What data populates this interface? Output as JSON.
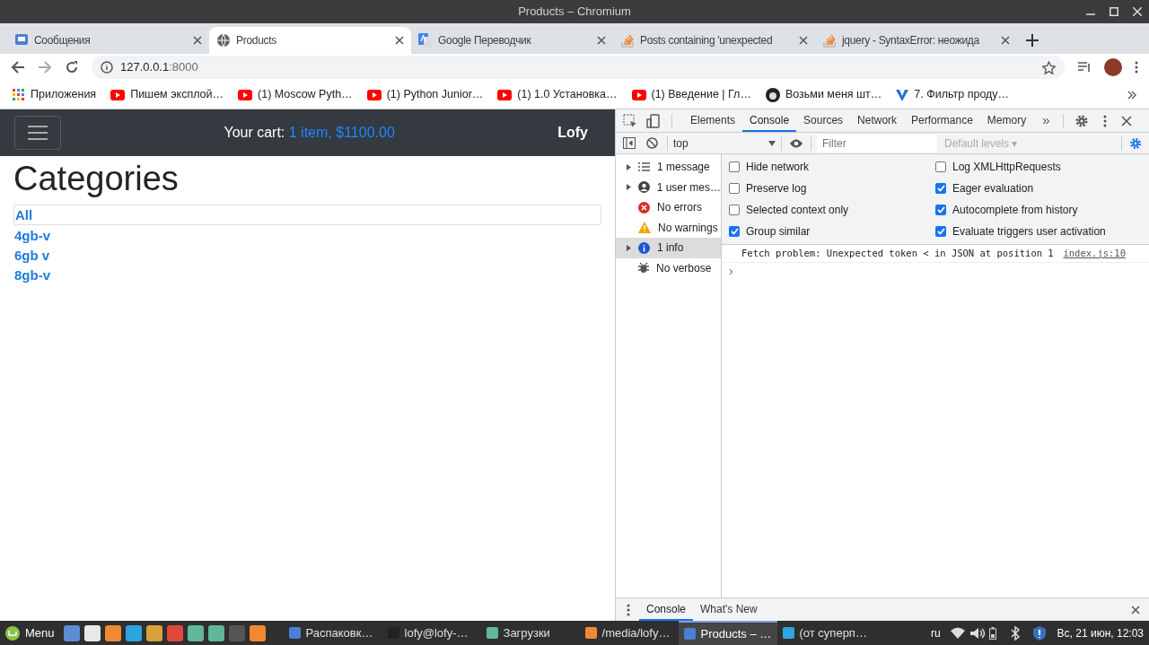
{
  "window": {
    "title": "Products – Chromium"
  },
  "tabs": [
    {
      "title": "Сообщения",
      "kind": "chat",
      "selected": false
    },
    {
      "title": "Products",
      "kind": "globe",
      "selected": true
    },
    {
      "title": "Google Переводчик",
      "kind": "translate",
      "selected": false
    },
    {
      "title": "Posts containing 'unexpected",
      "kind": "stack",
      "selected": false
    },
    {
      "title": "jquery - SyntaxError: неожида",
      "kind": "stack",
      "selected": false
    }
  ],
  "address": {
    "host": "127.0.0.1",
    "port": ":8000"
  },
  "bookmarks": [
    {
      "label": "Приложения",
      "kind": "apps"
    },
    {
      "label": "Пишем эксплой…",
      "kind": "video"
    },
    {
      "label": "(1) Moscow Pyth…",
      "kind": "video"
    },
    {
      "label": "(1) Python Junior…",
      "kind": "video"
    },
    {
      "label": "(1) 1.0 Установка…",
      "kind": "video"
    },
    {
      "label": "(1) Введение | Гл…",
      "kind": "video"
    },
    {
      "label": "Возьми меня шт…",
      "kind": "avatar"
    },
    {
      "label": "7. Фильтр проду…",
      "kind": "v"
    }
  ],
  "page": {
    "cart_label": "Your cart:",
    "cart_value": "1 item, $1100.00",
    "user": "Lofy",
    "heading": "Categories",
    "categories": [
      {
        "label": "All",
        "selected": true
      },
      {
        "label": "4gb-v",
        "selected": false
      },
      {
        "label": "6gb v",
        "selected": false
      },
      {
        "label": "8gb-v",
        "selected": false
      }
    ]
  },
  "devtools": {
    "tabs": [
      {
        "label": "Elements",
        "selected": false
      },
      {
        "label": "Console",
        "selected": true
      },
      {
        "label": "Sources",
        "selected": false
      },
      {
        "label": "Network",
        "selected": false
      },
      {
        "label": "Performance",
        "selected": false
      },
      {
        "label": "Memory",
        "selected": false
      }
    ],
    "overflow": "»",
    "context": "top",
    "filter_placeholder": "Filter",
    "levels": "Default levels ▾",
    "sidebar": [
      {
        "label": "1 message",
        "kind": "list",
        "expandable": true,
        "selected": false
      },
      {
        "label": "1 user mes…",
        "kind": "user",
        "expandable": true,
        "selected": false
      },
      {
        "label": "No errors",
        "kind": "error",
        "expandable": false,
        "selected": false
      },
      {
        "label": "No warnings",
        "kind": "warning",
        "expandable": false,
        "selected": false
      },
      {
        "label": "1 info",
        "kind": "info",
        "expandable": true,
        "selected": true
      },
      {
        "label": "No verbose",
        "kind": "verbose",
        "expandable": false,
        "selected": false
      }
    ],
    "settings": [
      {
        "label": "Hide network",
        "checked": false
      },
      {
        "label": "Log XMLHttpRequests",
        "checked": false
      },
      {
        "label": "Preserve log",
        "checked": false
      },
      {
        "label": "Eager evaluation",
        "checked": true
      },
      {
        "label": "Selected context only",
        "checked": false
      },
      {
        "label": "Autocomplete from history",
        "checked": true
      },
      {
        "label": "Group similar",
        "checked": true
      },
      {
        "label": "Evaluate triggers user activation",
        "checked": true
      }
    ],
    "logs": [
      {
        "text": "Fetch problem: Unexpected token < in JSON at position 1",
        "source": "index.js:10"
      }
    ],
    "prompt": "›",
    "drawer_tabs": [
      {
        "label": "Console",
        "selected": true
      },
      {
        "label": "What's New",
        "selected": false
      }
    ]
  },
  "taskbar": {
    "menu": "Menu",
    "launchers": [
      {
        "color": "#5b8dd6"
      },
      {
        "color": "#e8e8e8"
      },
      {
        "color": "#f08a30"
      },
      {
        "color": "#2ca5e0"
      },
      {
        "color": "#d9a13a"
      },
      {
        "color": "#e0483c"
      },
      {
        "color": "#5fb89a"
      },
      {
        "color": "#5fb89a"
      },
      {
        "color": "#555555"
      },
      {
        "color": "#f08a30"
      }
    ],
    "windows": [
      {
        "label": "Распаковк…",
        "color": "#4a7fd4",
        "selected": false
      },
      {
        "label": "lofy@lofy-…",
        "color": "#222222",
        "selected": false
      },
      {
        "label": "Загрузки",
        "color": "#5fb89a",
        "selected": false
      },
      {
        "label": "/media/lofy…",
        "color": "#f08a30",
        "selected": false
      },
      {
        "label": "Products – …",
        "color": "#4a7fd4",
        "selected": true
      },
      {
        "label": "(от суперп…",
        "color": "#2ca5e0",
        "selected": false
      }
    ],
    "lang": "ru",
    "clock": "Вс, 21 июн, 12:03"
  }
}
